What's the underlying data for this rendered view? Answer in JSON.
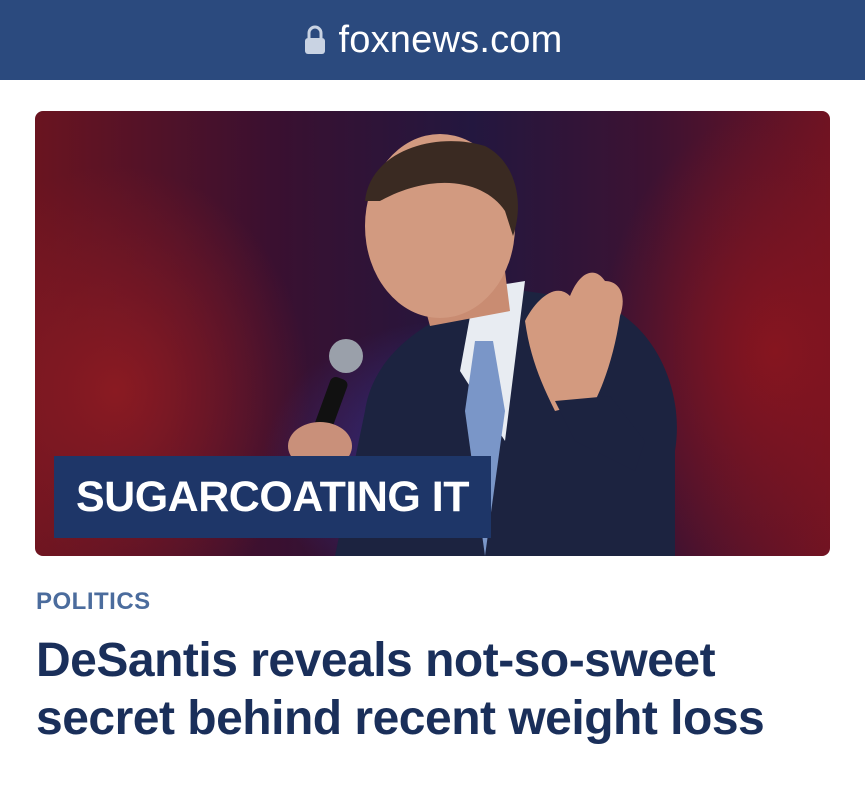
{
  "browser": {
    "url": "foxnews.com",
    "lock_icon": "lock-icon"
  },
  "article": {
    "kicker": "SUGARCOATING IT",
    "category": "POLITICS",
    "headline": "DeSantis reveals not-so-sweet secret behind recent weight loss"
  },
  "colors": {
    "url_bar": "#2b4a7e",
    "kicker_box": "#1e3668",
    "category": "#4b6c9d",
    "headline": "#1a2f5a"
  }
}
